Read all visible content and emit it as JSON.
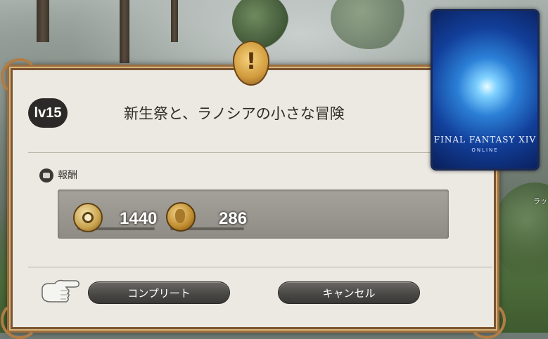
{
  "quest": {
    "level": "lv15",
    "title": "新生祭と、ラノシアの小さな冒険"
  },
  "rewards": {
    "label": "報酬",
    "items": [
      {
        "icon": "seal-icon",
        "value": "1440"
      },
      {
        "icon": "gil-coin-icon",
        "value": "286"
      }
    ]
  },
  "buttons": {
    "complete": "コンプリート",
    "cancel": "キャンセル"
  },
  "game_card": {
    "logo": "FINAL FANTASY XIV",
    "sub": "ONLINE"
  },
  "side_text": "ラッ"
}
